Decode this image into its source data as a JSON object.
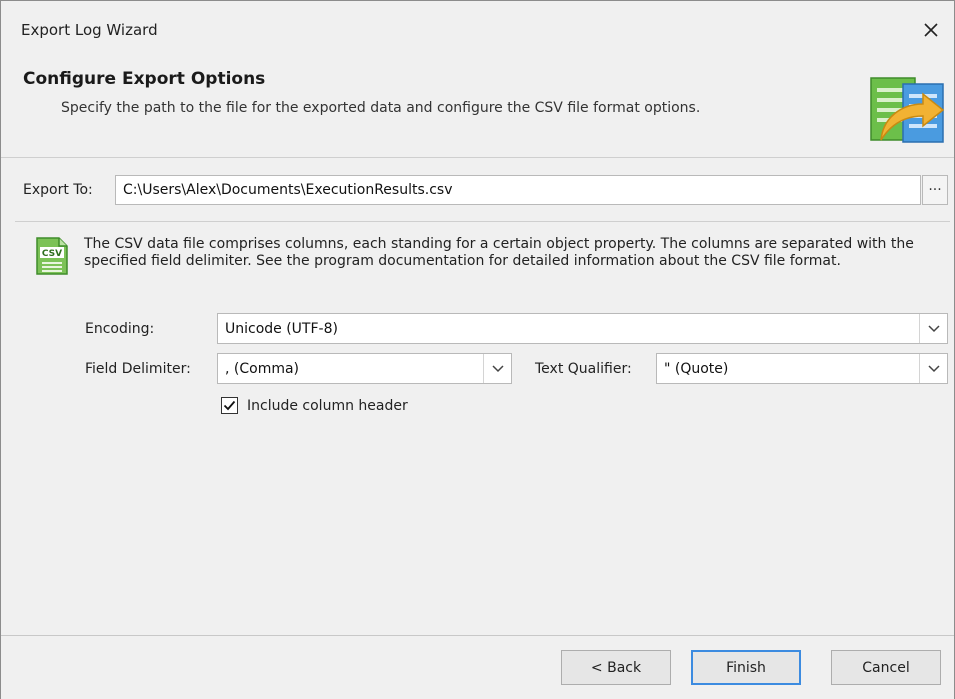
{
  "window": {
    "title": "Export Log Wizard"
  },
  "header": {
    "title": "Configure Export Options",
    "description": "Specify the path to the file for the exported data and configure the CSV file format options."
  },
  "export_to": {
    "label": "Export To:",
    "value": "C:\\Users\\Alex\\Documents\\ExecutionResults.csv",
    "browse_label": "···"
  },
  "info": {
    "icon_text": "CSV",
    "text": "The CSV data file comprises columns, each standing for a certain object property. The columns are separated with the specified field delimiter. See the program documentation for detailed information about the CSV file format."
  },
  "encoding": {
    "label": "Encoding:",
    "value": "Unicode (UTF-8)"
  },
  "field_delimiter": {
    "label": "Field Delimiter:",
    "value": ", (Comma)"
  },
  "text_qualifier": {
    "label": "Text Qualifier:",
    "value": "\" (Quote)"
  },
  "include_header": {
    "label": "Include column header",
    "checked": true
  },
  "footer": {
    "back_label": "< Back",
    "finish_label": "Finish",
    "cancel_label": "Cancel"
  },
  "colors": {
    "accent": "#3c8be0",
    "icon_green": "#6cbf4a",
    "icon_arrow": "#f2b233"
  }
}
